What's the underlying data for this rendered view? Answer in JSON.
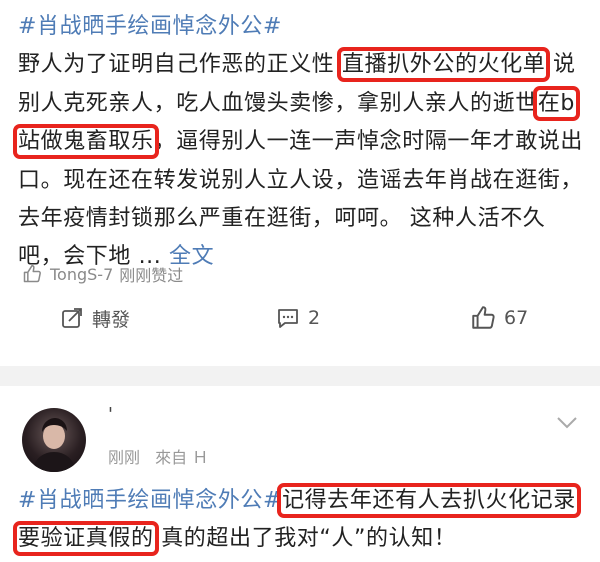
{
  "post1": {
    "hashtag": "#肖战晒手绘画悼念外公#",
    "seg1": "野人为了证明自己作恶的正义性 ",
    "hl1": "直播扒外公的火化单",
    "seg2": " 说别人克死亲人，吃人血馒头卖惨，拿别人亲人的逝世",
    "hl2": "在b站做鬼畜取乐",
    "seg3": "，逼得别人一连一声悼念时隔一年才敢说出口。现在还在转发说别人立人设，造谣去年肖战在逛街，去年疫情封锁那么严重在逛街，呵呵。 这种人活不久吧，会下地 ... ",
    "full_link": "全文",
    "liked_by_user": "TongS-7",
    "liked_by_suffix": "刚刚赞过",
    "actions": {
      "repost": "轉發",
      "comments": "2",
      "likes": "67"
    }
  },
  "post2": {
    "username": "'",
    "time": "刚刚",
    "source": "來自 Ｈ",
    "hashtag": "#肖战晒手绘画悼念外公#",
    "hl1": "记得去年还有人去扒火化记录要验证真假的",
    "seg1": " 真的超出了我对“人”的认知！"
  },
  "colors": {
    "highlight": "#e8241d",
    "link": "#4f7cb6",
    "divider": "#f2f2f2"
  }
}
